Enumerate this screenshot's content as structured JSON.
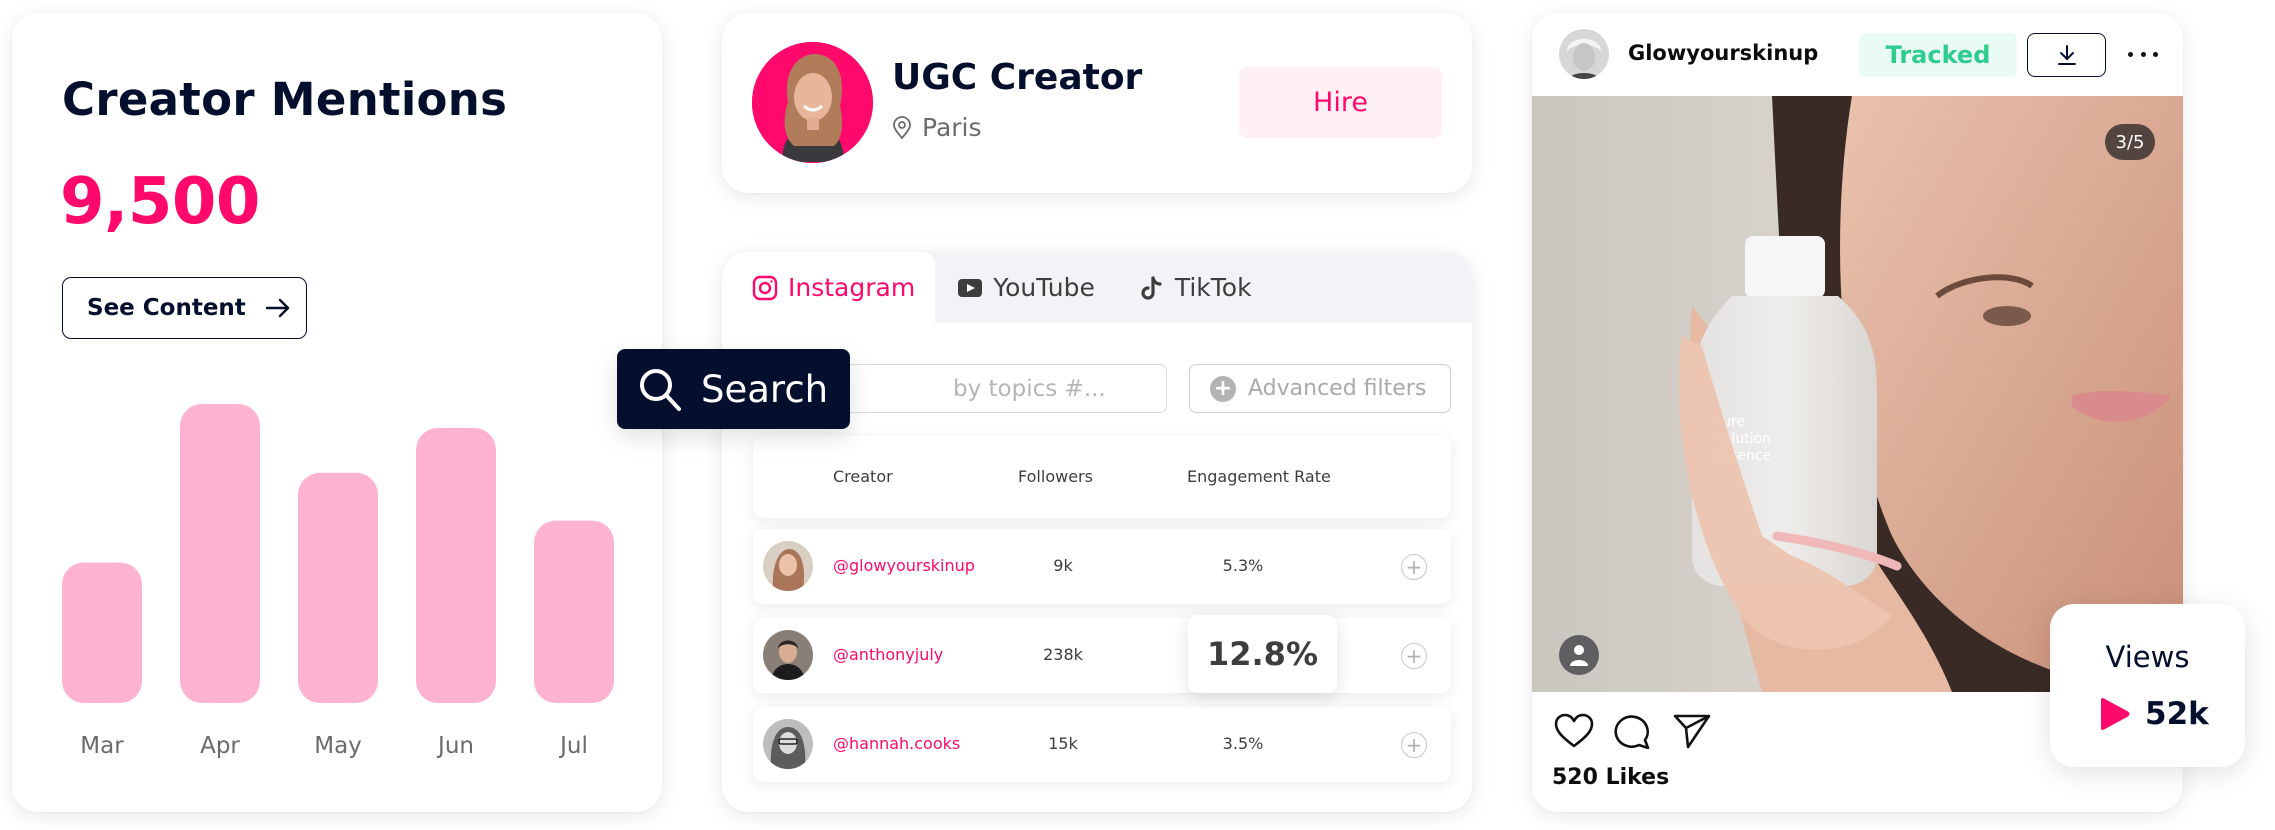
{
  "mentions": {
    "title": "Creator Mentions",
    "value": "9,500",
    "see_content_label": "See Content",
    "see_content_icon": "arrow-right-icon"
  },
  "chart_data": {
    "type": "bar",
    "title": "",
    "xlabel": "",
    "ylabel": "",
    "categories": [
      "Mar",
      "Apr",
      "May",
      "Jun",
      "Jul"
    ],
    "values": [
      47,
      100,
      77,
      92,
      61
    ],
    "value_units": "relative (Apr = 100, no axis shown)",
    "ylim": [
      0,
      100
    ],
    "grid": false,
    "legend": "none",
    "bar_color": "#ffb3d1"
  },
  "profile": {
    "name": "UGC Creator",
    "location": "Paris",
    "location_icon": "map-pin-icon",
    "hire_label": "Hire",
    "avatar_bg": "#ff0a6c"
  },
  "search": {
    "button_label": "Search",
    "button_icon": "search-icon",
    "input_placeholder": "by topics #...",
    "advanced_filters_label": "Advanced filters",
    "tabs": [
      {
        "label": "Instagram",
        "icon": "instagram-icon",
        "active": true
      },
      {
        "label": "YouTube",
        "icon": "youtube-icon",
        "active": false
      },
      {
        "label": "TikTok",
        "icon": "tiktok-icon",
        "active": false
      }
    ],
    "table": {
      "columns": [
        "Creator",
        "Followers",
        "Engagement Rate"
      ],
      "rows": [
        {
          "handle": "@glowyourskinup",
          "followers": "9k",
          "engagement": "5.3%"
        },
        {
          "handle": "@anthonyjuly",
          "followers": "238k",
          "engagement": "12.8%",
          "highlighted": true
        },
        {
          "handle": "@hannah.cooks",
          "followers": "15k",
          "engagement": "3.5%"
        }
      ],
      "add_icon": "plus-circle-icon"
    }
  },
  "post": {
    "username": "Glowyourskinup",
    "status_badge": "Tracked",
    "slide_counter": "3/5",
    "product_text": [
      "Pure",
      "Solution",
      "Essence"
    ],
    "likes": "520 Likes",
    "actions": [
      "heart-icon",
      "comment-icon",
      "share-icon"
    ]
  },
  "views": {
    "label": "Views",
    "value": "52k",
    "icon": "play-icon"
  },
  "colors": {
    "brand_pink": "#ff0a6c",
    "navy": "#040f2d",
    "bar_pink": "#ffb3d1",
    "tracked_green": "#2ecc8f",
    "tracked_bg": "#eafaf5",
    "hire_bg": "#fff0f4"
  }
}
